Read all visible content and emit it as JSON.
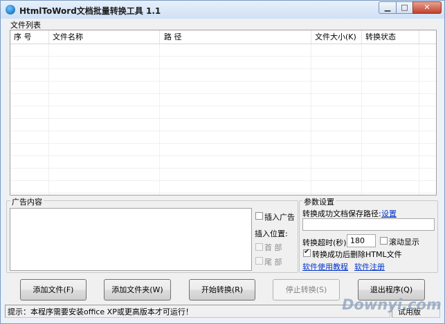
{
  "window": {
    "title": "HtmlToWord文档批量转换工具 1.1",
    "min_glyph": "▁",
    "max_glyph": "□",
    "close_glyph": "✕"
  },
  "file_list": {
    "group_label": "文件列表",
    "columns": [
      "序  号",
      "文件名称",
      "路  径",
      "文件大小(K)",
      "转换状态"
    ],
    "rows": []
  },
  "ad": {
    "group_label": "广告内容",
    "content": "",
    "insert_ad_label": "插入广告",
    "insert_ad_checked": false,
    "position_label": "插入位置:",
    "head_label": "首      部",
    "tail_label": "尾      部"
  },
  "params": {
    "group_label": "参数设置",
    "save_path_label": "转换成功文档保存路径:",
    "settings_link": "设置",
    "save_path_value": "",
    "timeout_label": "转换超时(秒):",
    "timeout_value": "180",
    "scroll_label": "滚动显示",
    "scroll_checked": false,
    "delete_html_label": "转换成功后删除HTML文件",
    "delete_html_checked": true,
    "tutorial_link": "软件使用教程",
    "register_link": "软件注册"
  },
  "buttons": {
    "add_file": "添加文件(F)",
    "add_folder": "添加文件夹(W)",
    "start": "开始转换(R)",
    "stop": "停止转换(S)",
    "exit": "退出程序(Q)"
  },
  "status": {
    "hint": "提示：本程序需要安装office XP或更高版本才可运行！",
    "edition": "试用版"
  },
  "watermark": "Downyi.com",
  "colors": {
    "link": "#0033cc",
    "close_button": "#c0402c"
  }
}
